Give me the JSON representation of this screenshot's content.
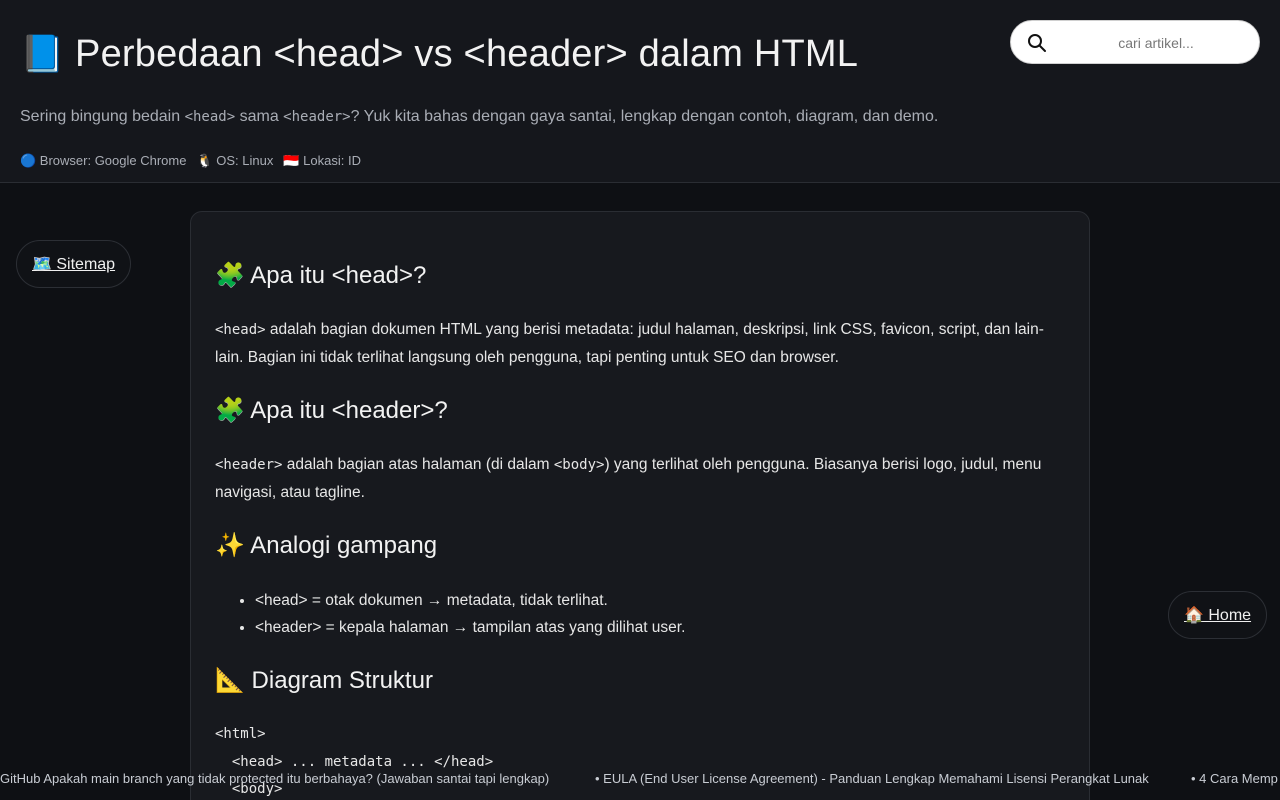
{
  "header": {
    "title_emoji": "📘",
    "title": "Perbedaan <head> vs <header> dalam HTML",
    "subtitle_part1": "Sering bingung bedain ",
    "subtitle_code1": "<head>",
    "subtitle_part2": " sama ",
    "subtitle_code2": "<header>",
    "subtitle_part3": "? Yuk kita bahas dengan gaya santai, lengkap dengan contoh, diagram, dan demo.",
    "meta": {
      "browser": "🔵 Browser: Google Chrome",
      "os": "🐧 OS: Linux",
      "location": "🇮🇩 Lokasi: ID"
    }
  },
  "search": {
    "placeholder": "cari artikel...",
    "value": "",
    "icon": "search-icon"
  },
  "nav": {
    "sitemap_label": "🗺️ Sitemap",
    "home_label": "🏠 Home"
  },
  "article": {
    "h_head": "🧩 Apa itu <head>?",
    "p_head_code": "<head>",
    "p_head_text": " adalah bagian dokumen HTML yang berisi metadata: judul halaman, deskripsi, link CSS, favicon, script, dan lain-lain. Bagian ini tidak terlihat langsung oleh pengguna, tapi penting untuk SEO dan browser.",
    "h_header": "🧩 Apa itu <header>?",
    "p_header_code1": "<header>",
    "p_header_text1": " adalah bagian atas halaman (di dalam ",
    "p_header_code2": "<body>",
    "p_header_text2": ") yang terlihat oleh pengguna. Biasanya berisi logo, judul, menu navigasi, atau tagline.",
    "h_analogy": "✨ Analogi gampang",
    "analogy_items": [
      "<head> = otak dokumen → metadata, tidak terlihat.",
      "<header> = kepala halaman → tampilan atas yang dilihat user."
    ],
    "h_diagram": "📐 Diagram Struktur",
    "diagram_lines": [
      "<html>",
      "  <head> ... metadata ... </head>",
      "  <body>"
    ]
  },
  "ticker": [
    "GitHub Apakah main branch yang tidak protected itu berbahaya? (Jawaban santai tapi lengkap)",
    "• EULA (End User License Agreement) - Panduan Lengkap Memahami Lisensi Perangkat Lunak",
    "• 4 Cara Memp"
  ]
}
